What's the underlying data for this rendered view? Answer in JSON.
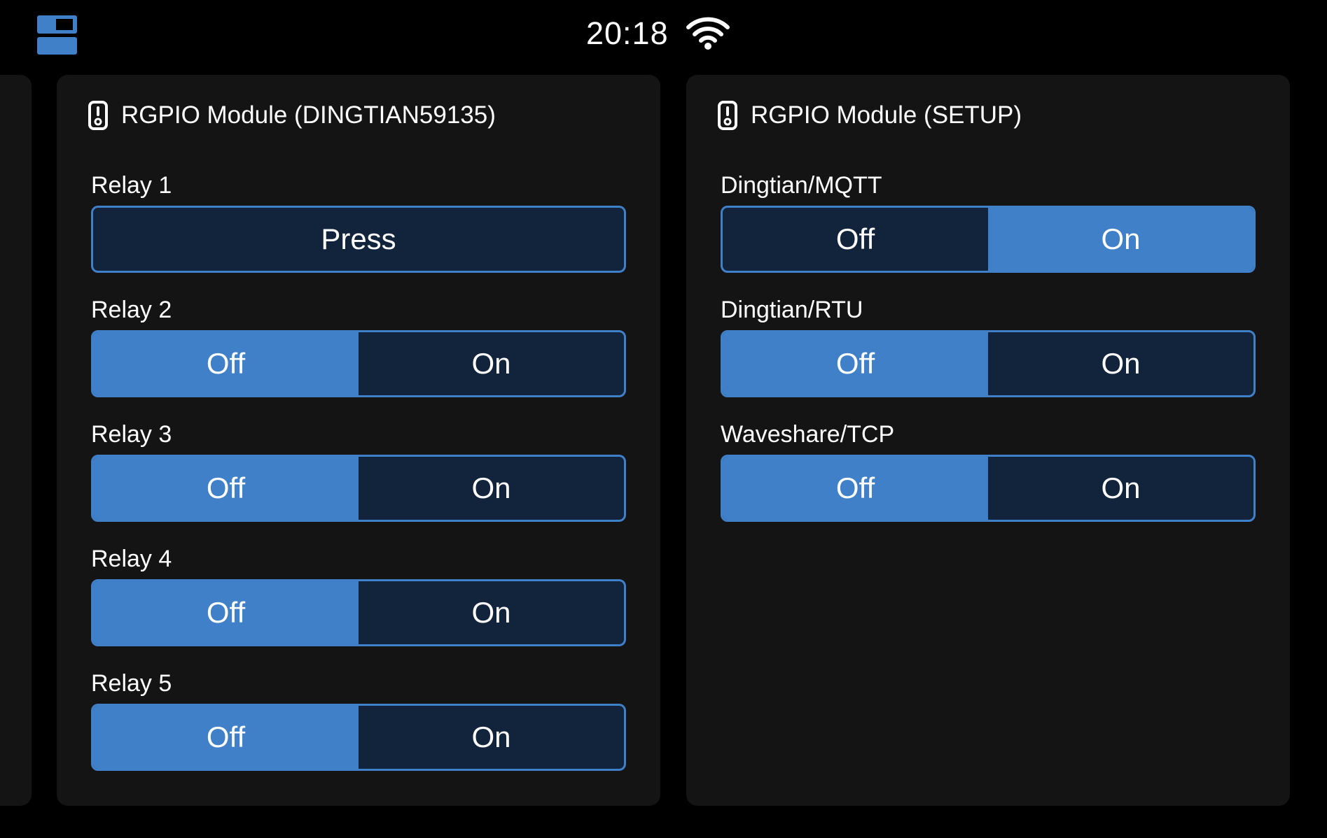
{
  "status_bar": {
    "time": "20:18",
    "menu_icon": "dashboard-toggle-icon",
    "wifi_icon": "wifi-icon"
  },
  "colors": {
    "background": "#000000",
    "panel": "#141414",
    "accent": "#3f80c8",
    "inactive_segment": "#12243b"
  },
  "panels": [
    {
      "title": "RGPIO Module (DINGTIAN59135)",
      "icon": "remote-icon",
      "rows": [
        {
          "label": "Relay 1",
          "type": "button",
          "button_label": "Press"
        },
        {
          "label": "Relay 2",
          "type": "toggle",
          "off_label": "Off",
          "on_label": "On",
          "state": "off"
        },
        {
          "label": "Relay 3",
          "type": "toggle",
          "off_label": "Off",
          "on_label": "On",
          "state": "off"
        },
        {
          "label": "Relay 4",
          "type": "toggle",
          "off_label": "Off",
          "on_label": "On",
          "state": "off"
        },
        {
          "label": "Relay 5",
          "type": "toggle",
          "off_label": "Off",
          "on_label": "On",
          "state": "off"
        }
      ]
    },
    {
      "title": "RGPIO Module (SETUP)",
      "icon": "remote-icon",
      "rows": [
        {
          "label": "Dingtian/MQTT",
          "type": "toggle",
          "off_label": "Off",
          "on_label": "On",
          "state": "on"
        },
        {
          "label": "Dingtian/RTU",
          "type": "toggle",
          "off_label": "Off",
          "on_label": "On",
          "state": "off"
        },
        {
          "label": "Waveshare/TCP",
          "type": "toggle",
          "off_label": "Off",
          "on_label": "On",
          "state": "off"
        }
      ]
    }
  ]
}
